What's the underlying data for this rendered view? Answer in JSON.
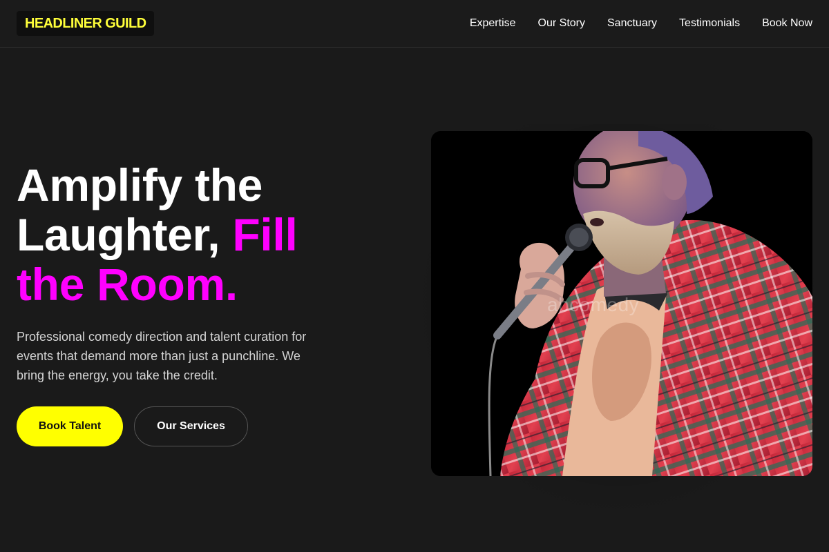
{
  "header": {
    "logo": "HEADLINER GUILD",
    "nav": [
      "Expertise",
      "Our Story",
      "Sanctuary",
      "Testimonials",
      "Book Now"
    ]
  },
  "hero": {
    "title_line1": "Amplify the",
    "title_line2_plain": "Laughter, ",
    "title_line2_accent": "Fill",
    "title_line3_accent": "the Room.",
    "subtitle": "Professional comedy direction and talent curation for events that demand more than just a punchline. We bring the energy, you take the credit.",
    "primary_button": "Book Talent",
    "secondary_button": "Our Services"
  },
  "photo": {
    "watermark": "abcomedy",
    "icon": "comedian-photo"
  },
  "colors": {
    "background": "#1a1a1a",
    "logo_text": "#ffff3a",
    "accent": "#ff00ff",
    "primary_button": "#ffff00"
  }
}
